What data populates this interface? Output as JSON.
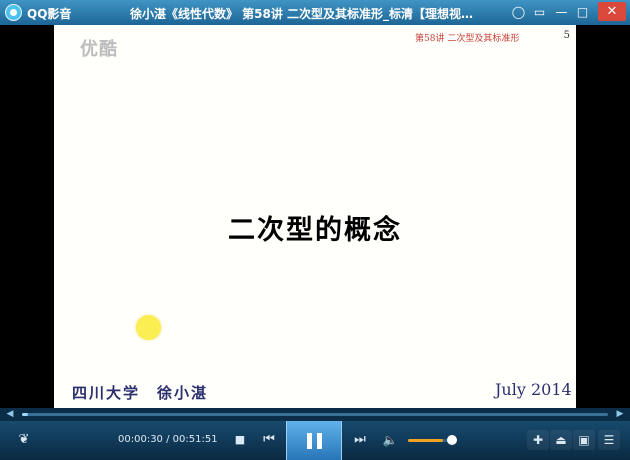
{
  "app": {
    "name": "QQ影音",
    "logo": "qq-player-logo"
  },
  "window": {
    "title": "徐小湛《线性代数》 第58讲 二次型及其标准形_标清【理想视…",
    "controls": [
      {
        "name": "skin-icon",
        "glyph": "◯"
      },
      {
        "name": "mini-mode-icon",
        "glyph": "▭"
      },
      {
        "name": "minimize-icon",
        "glyph": "—"
      },
      {
        "name": "maximize-icon",
        "glyph": "□"
      },
      {
        "name": "close-icon",
        "glyph": "✕"
      }
    ]
  },
  "video": {
    "watermark": "优酷",
    "slide": {
      "header": "第58讲 二次型及其标准形",
      "page": "5",
      "title": "二次型的概念",
      "author": "四川大学　徐小湛",
      "date": "July 2014",
      "pointer_color": "#fbee52"
    }
  },
  "seekbar": {
    "progress": 0.0097,
    "prev_glyph": "◀",
    "next_glyph": "▶"
  },
  "player": {
    "current_time": "00:00:30",
    "total_time": "00:51:51",
    "time_separator": " / ",
    "volume": 0.8,
    "accent_color": "#f2a321",
    "icons": {
      "footprint": "❦",
      "stop": "■",
      "prev": "⏮",
      "next": "⏭",
      "volume": "🔈",
      "tools": "✚",
      "eject": "⏏",
      "screen": "▣",
      "playlist": "☰"
    }
  }
}
